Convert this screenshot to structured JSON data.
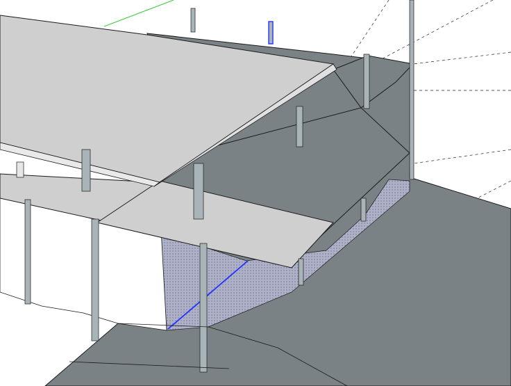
{
  "viewport": {
    "colors": {
      "sky": "#ffffff",
      "ground_plane": "#7b8286",
      "roof_top": "#cfcfcf",
      "roof_edge": "#e9e9e9",
      "canopy_light": "#cfcfcf",
      "canopy_dark": "#7b8286",
      "wall_face": "#ffffff",
      "wall_back_face": "#aeb1c8",
      "post_fill": "#a8b4b8",
      "post_cap": "#e6e6e6",
      "selected_edge": "#2233ff",
      "green_axis": "#33cc33",
      "edge_line": "#1a1a1a",
      "guide_line": "#222222"
    }
  }
}
